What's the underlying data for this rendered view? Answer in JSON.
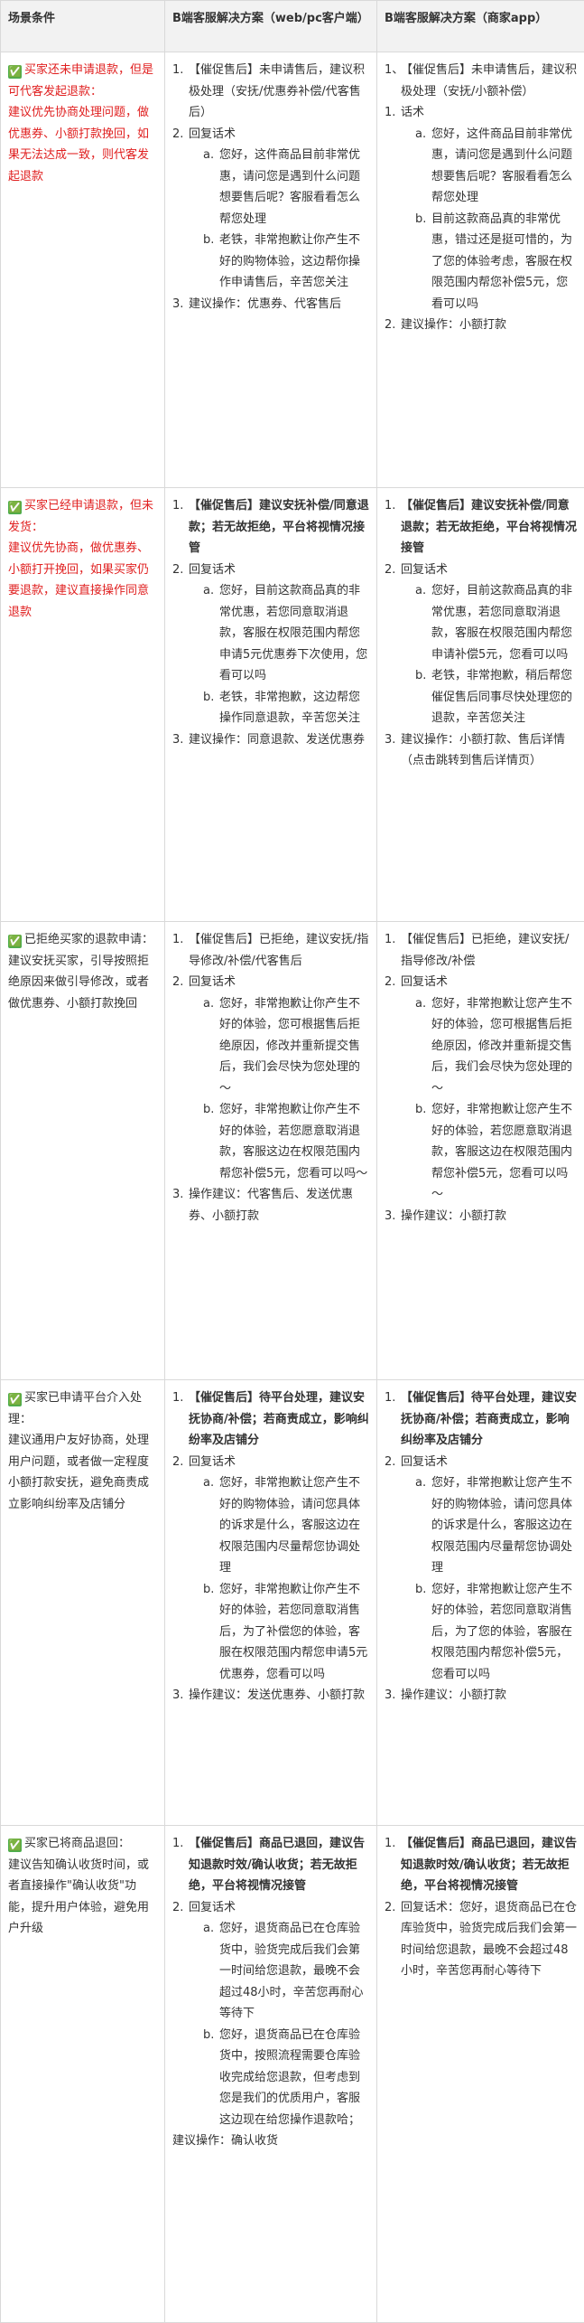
{
  "headers": [
    "场景条件",
    "B端客服解决方案（web/pc客户端）",
    "B端客服解决方案（商家app）"
  ],
  "check_icon": "✅",
  "rows": [
    {
      "cond_title": "买家还未申请退款，但是可代客发起退款：",
      "cond_body": "建议优先协商处理问题，做优惠券、小额打款挽回，如果无法达成一致，则代客发起退款",
      "web": {
        "i1_num": "1.",
        "i1_lead": "【催促售后】",
        "i1_text": "未申请售后，建议积极处理（安抚/优惠券补偿/代客售后）",
        "i2_num": "2.",
        "i2_text": "回复话术",
        "a_num": "a.",
        "a_text": "您好，这件商品目前非常优惠，请问您是遇到什么问题想要售后呢？客服看看怎么帮您处理",
        "b_num": "b.",
        "b_text": "老铁，非常抱歉让你产生不好的购物体验，这边帮你操作申请售后，辛苦您关注",
        "i3_num": "3.",
        "i3_text": "建议操作：优惠券、代客售后"
      },
      "app": {
        "i1_num": "1、",
        "i1_lead": "【催促售后】",
        "i1_text": "未申请售后，建议积极处理（安抚/小额补偿）",
        "i2_num": "1.",
        "i2_text": "话术",
        "a_num": "a.",
        "a_text": "您好，这件商品目前非常优惠，请问您是遇到什么问题想要售后呢？客服看看怎么帮您处理",
        "b_num": "b.",
        "b_text": "目前这款商品真的非常优惠，错过还是挺可惜的，为了您的体验考虑，客服在权限范围内帮您补偿5元，您看可以吗",
        "i3_num": "2.",
        "i3_text": "建议操作：小额打款"
      }
    },
    {
      "cond_title": "买家已经申请退款，但未发货：",
      "cond_body": "建议优先协商，做优惠券、小额打开挽回，如果买家仍要退款，建议直接操作同意退款",
      "web": {
        "i1_num": "1.",
        "i1_text": "【催促售后】建议安抚补偿/同意退款；若无故拒绝，平台将视情况接管",
        "i2_num": "2.",
        "i2_text": "回复话术",
        "a_num": "a.",
        "a_text": "您好，目前这款商品真的非常优惠，若您同意取消退款，客服在权限范围内帮您申请5元优惠券下次使用，您看可以吗",
        "b_num": "b.",
        "b_text": "老铁，非常抱歉，这边帮您操作同意退款，辛苦您关注",
        "i3_num": "3.",
        "i3_text": "建议操作：同意退款、发送优惠券"
      },
      "app": {
        "i1_num": "1.",
        "i1_text": "【催促售后】建议安抚补偿/同意退款；若无故拒绝，平台将视情况接管",
        "i2_num": "2.",
        "i2_text": "回复话术",
        "a_num": "a.",
        "a_text": "您好，目前这款商品真的非常优惠，若您同意取消退款，客服在权限范围内帮您申请补偿5元，您看可以吗",
        "b_num": "b.",
        "b_text": "老铁，非常抱歉，稍后帮您催促售后同事尽快处理您的退款，辛苦您关注",
        "i3_num": "3.",
        "i3_text": "建议操作：小额打款、售后详情（点击跳转到售后详情页）"
      }
    },
    {
      "cond_title": "已拒绝买家的退款申请：",
      "cond_body": "建议安抚买家，引导按照拒绝原因来做引导修改，或者做优惠券、小额打款挽回",
      "web": {
        "i1_num": "1.",
        "i1_lead": "【催促售后】",
        "i1_text": "已拒绝，建议安抚/指导修改/补偿/代客售后",
        "i2_num": "2.",
        "i2_text": "回复话术",
        "a_num": "a.",
        "a_text": "您好，非常抱歉让你产生不好的体验，您可根据售后拒绝原因，修改并重新提交售后，我们会尽快为您处理的～",
        "b_num": "b.",
        "b_text": "您好，非常抱歉让你产生不好的体验，若您愿意取消退款，客服这边在权限范围内帮您补偿5元，您看可以吗～",
        "i3_num": "3.",
        "i3_text": "操作建议：代客售后、发送优惠券、小额打款"
      },
      "app": {
        "i1_num": "1.",
        "i1_lead": "【催促售后】",
        "i1_text": "已拒绝，建议安抚/指导修改/补偿",
        "i2_num": "2.",
        "i2_text": "回复话术",
        "a_num": "a.",
        "a_text": "您好，非常抱歉让您产生不好的体验，您可根据售后拒绝原因，修改并重新提交售后，我们会尽快为您处理的～",
        "b_num": "b.",
        "b_text": "您好，非常抱歉让您产生不好的体验，若您愿意取消退款，客服这边在权限范围内帮您补偿5元，您看可以吗～",
        "i3_num": "3.",
        "i3_text": "操作建议：小额打款"
      }
    },
    {
      "cond_title": "买家已申请平台介入处理：",
      "cond_body": "建议通用户友好协商，处理用户问题，或者做一定程度小额打款安抚，避免商责成立影响纠纷率及店铺分",
      "web": {
        "i1_num": "1.",
        "i1_text": "【催促售后】待平台处理，建议安抚协商/补偿；若商责成立，影响纠纷率及店铺分",
        "i2_num": "2.",
        "i2_text": "回复话术",
        "a_num": "a.",
        "a_text": "您好，非常抱歉让您产生不好的购物体验，请问您具体的诉求是什么，客服这边在权限范围内尽量帮您协调处理",
        "b_num": "b.",
        "b_text": "您好，非常抱歉让你产生不好的体验，若您同意取消售后，为了补偿您的体验，客服在权限范围内帮您申请5元优惠券，您看可以吗",
        "i3_num": "3.",
        "i3_text": "操作建议：发送优惠券、小额打款"
      },
      "app": {
        "i1_num": "1.",
        "i1_text": "【催促售后】待平台处理，建议安抚协商/补偿；若商责成立，影响纠纷率及店铺分",
        "i2_num": "2.",
        "i2_text": "回复话术",
        "a_num": "a.",
        "a_text": "您好，非常抱歉让您产生不好的购物体验，请问您具体的诉求是什么，客服这边在权限范围内尽量帮您协调处理",
        "b_num": "b.",
        "b_text": "您好，非常抱歉让您产生不好的体验，若您同意取消售后，为了您的体验，客服在权限范围内帮您补偿5元，您看可以吗",
        "i3_num": "3.",
        "i3_text": "操作建议：小额打款"
      }
    },
    {
      "cond_title": "买家已将商品退回：",
      "cond_body": "建议告知确认收货时间，或者直接操作\"确认收货\"功能，提升用户体验，避免用户升级",
      "web": {
        "i1_num": "1.",
        "i1_text": "【催促售后】商品已退回，建议告知退款时效/确认收货；若无故拒绝，平台将视情况接管",
        "i2_num": "2.",
        "i2_text": "回复话术",
        "a_num": "a.",
        "a_text": "您好，退货商品已在仓库验货中，验货完成后我们会第一时间给您退款，最晚不会超过48小时，辛苦您再耐心等待下",
        "b_num": "b.",
        "b_text": "您好，退货商品已在仓库验货中，按照流程需要仓库验收完成给您退款，但考虑到您是我们的优质用户，客服这边现在给您操作退款哈；",
        "op_text": "建议操作：确认收货"
      },
      "app": {
        "i1_num": "1.",
        "i1_text": "【催促售后】商品已退回，建议告知退款时效/确认收货；若无故拒绝，平台将视情况接管",
        "i2_num": "2.",
        "i2_text": "回复话术：您好，退货商品已在仓库验货中，验货完成后我们会第一时间给您退款，最晚不会超过48小时，辛苦您再耐心等待下"
      }
    }
  ]
}
